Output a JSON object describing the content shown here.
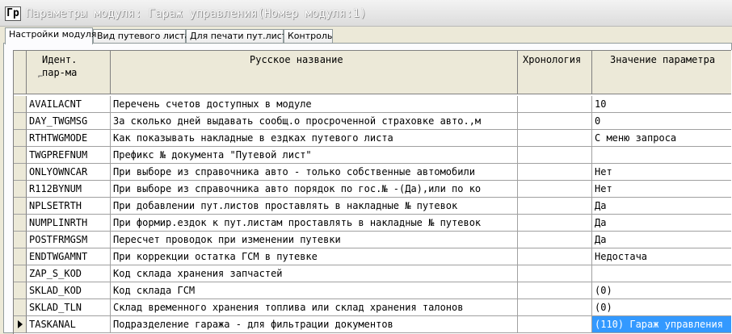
{
  "window": {
    "icon_glyph": "Гр",
    "title": "Параметры модуля: Гараж управления(Номер модуля:1)"
  },
  "tabs": [
    {
      "label": "Настройки модуля",
      "active": true
    },
    {
      "label": "Вид путевого листа",
      "active": false
    },
    {
      "label": "Для печати пут.листа",
      "active": false
    },
    {
      "label": "Контроль",
      "active": false
    }
  ],
  "grid": {
    "headers": {
      "id_line1": "Идент.",
      "id_line2": "пар-ма",
      "name": "Русское название",
      "chronology": "Хронология",
      "value": "Значение параметра"
    },
    "rows": [
      {
        "id": "AVAILACNT",
        "name": "Перечень счетов доступных в модуле",
        "chronology": "",
        "value": "10"
      },
      {
        "id": "DAY_TWGMSG",
        "name": "За сколько дней выдавать сообщ.о просроченной страховке авто.,м",
        "chronology": "",
        "value": "0"
      },
      {
        "id": "RTHTWGMODE",
        "name": "Как показывать накладные в ездках путевого листа",
        "chronology": "",
        "value": "С меню запроса"
      },
      {
        "id": "TWGPREFNUM",
        "name": "Префикс № документа \"Путевой лист\"",
        "chronology": "",
        "value": ""
      },
      {
        "id": "ONLYOWNCAR",
        "name": "При выборе из справочника авто - только собственные автомобили",
        "chronology": "",
        "value": "Нет"
      },
      {
        "id": "R112BYNUM",
        "name": "При выборе из справочника авто порядок по гос.№ -(Да),или по ко",
        "chronology": "",
        "value": "Нет"
      },
      {
        "id": "NPLSETRTH",
        "name": "При добавлении пут.листов проставлять в накладные № путевок",
        "chronology": "",
        "value": "Да"
      },
      {
        "id": "NUMPLINRTH",
        "name": "При формир.ездок к пут.листам проставлять в накладные № путевок",
        "chronology": "",
        "value": "Да"
      },
      {
        "id": "POSTFRMGSM",
        "name": "Пересчет проводок при изменении путевки",
        "chronology": "",
        "value": "Да"
      },
      {
        "id": "ENDTWGAMNT",
        "name": "При коррекции остатка ГСМ в путевке",
        "chronology": "",
        "value": "Недостача"
      },
      {
        "id": "ZAP_S_KOD",
        "name": "Код склада хранения запчастей",
        "chronology": "",
        "value": ""
      },
      {
        "id": "SKLAD_KOD",
        "name": "Код склада ГСМ",
        "chronology": "",
        "value": "(0)"
      },
      {
        "id": "SKLAD_TLN",
        "name": "Склад временного хранения топлива или склад хранения талонов",
        "chronology": "",
        "value": "(0)"
      },
      {
        "id": "TASKANAL",
        "name": "Подразделение гаража - для фильтрации документов",
        "chronology": "",
        "value": "(110) Гараж управления",
        "current": true
      }
    ]
  },
  "colors": {
    "selection": "#3399ff",
    "header_bg": "#ece9d8"
  }
}
